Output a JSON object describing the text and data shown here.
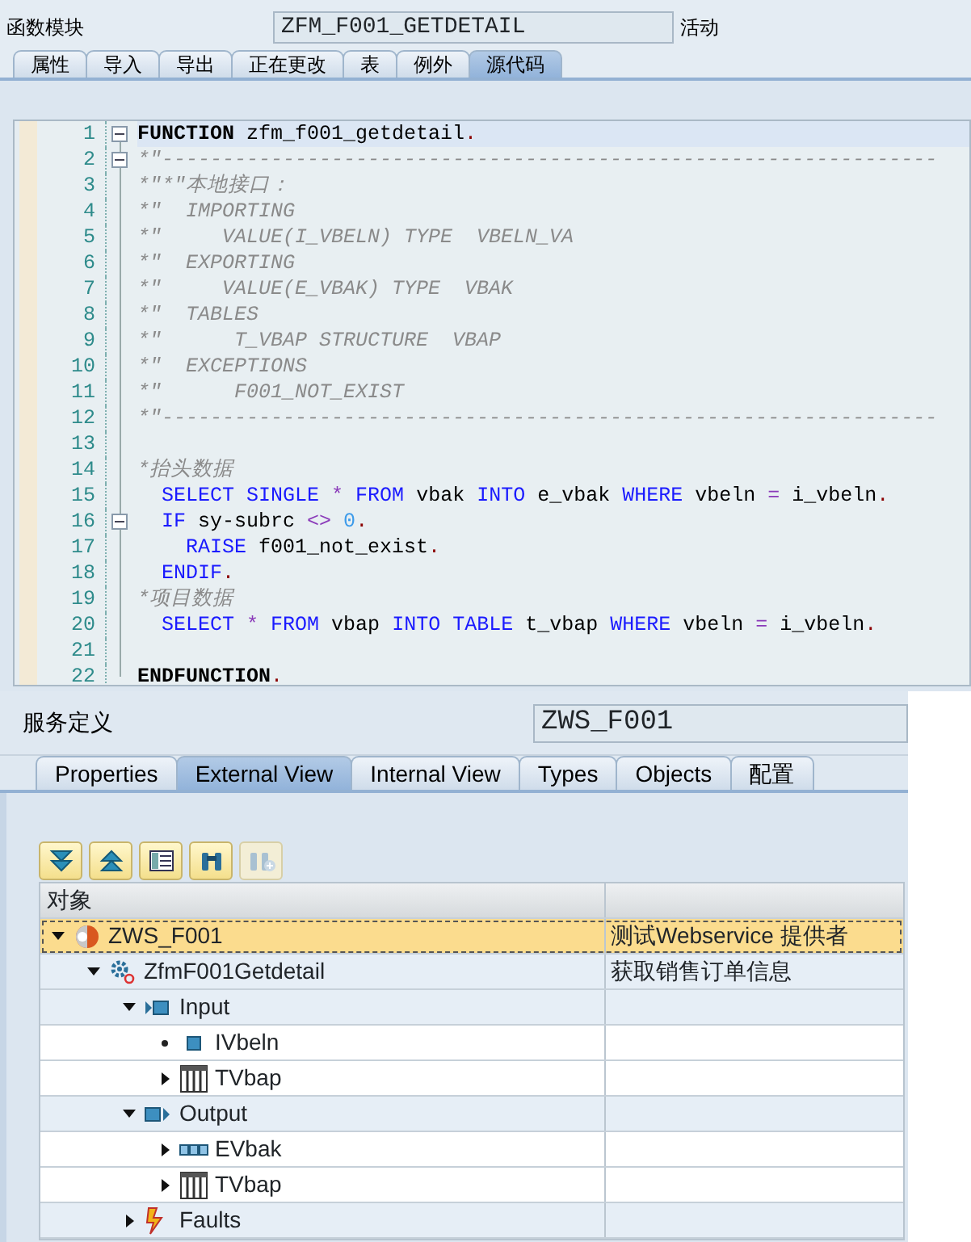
{
  "function_editor": {
    "field_label": "函数模块",
    "field_value": "ZFM_F001_GETDETAIL",
    "status": "活动",
    "tabs": [
      {
        "label": "属性",
        "selected": false
      },
      {
        "label": "导入",
        "selected": false
      },
      {
        "label": "导出",
        "selected": false
      },
      {
        "label": "正在更改",
        "selected": false
      },
      {
        "label": "表",
        "selected": false
      },
      {
        "label": "例外",
        "selected": false
      },
      {
        "label": "源代码",
        "selected": true
      }
    ],
    "code_lines": [
      {
        "number": "1",
        "fold_box": true,
        "current": true,
        "tokens": [
          {
            "kind": "bold_keyword",
            "text": "FUNCTION"
          },
          {
            "kind": "text",
            "text": " zfm_f001_getdetail"
          },
          {
            "kind": "punct",
            "text": "."
          }
        ]
      },
      {
        "number": "2",
        "fold_box": true,
        "current": false,
        "tokens": [
          {
            "kind": "comment",
            "text": "*\"----------------------------------------------------------------"
          }
        ]
      },
      {
        "number": "3",
        "fold_box": false,
        "current": false,
        "tokens": [
          {
            "kind": "comment",
            "text": "*\"*\"本地接口："
          }
        ]
      },
      {
        "number": "4",
        "fold_box": false,
        "current": false,
        "tokens": [
          {
            "kind": "comment",
            "text": "*\"  IMPORTING"
          }
        ]
      },
      {
        "number": "5",
        "fold_box": false,
        "current": false,
        "tokens": [
          {
            "kind": "comment",
            "text": "*\"     VALUE(I_VBELN) TYPE  VBELN_VA"
          }
        ]
      },
      {
        "number": "6",
        "fold_box": false,
        "current": false,
        "tokens": [
          {
            "kind": "comment",
            "text": "*\"  EXPORTING"
          }
        ]
      },
      {
        "number": "7",
        "fold_box": false,
        "current": false,
        "tokens": [
          {
            "kind": "comment",
            "text": "*\"     VALUE(E_VBAK) TYPE  VBAK"
          }
        ]
      },
      {
        "number": "8",
        "fold_box": false,
        "current": false,
        "tokens": [
          {
            "kind": "comment",
            "text": "*\"  TABLES"
          }
        ]
      },
      {
        "number": "9",
        "fold_box": false,
        "current": false,
        "tokens": [
          {
            "kind": "comment",
            "text": "*\"      T_VBAP STRUCTURE  VBAP"
          }
        ]
      },
      {
        "number": "10",
        "fold_box": false,
        "current": false,
        "tokens": [
          {
            "kind": "comment",
            "text": "*\"  EXCEPTIONS"
          }
        ]
      },
      {
        "number": "11",
        "fold_box": false,
        "current": false,
        "tokens": [
          {
            "kind": "comment",
            "text": "*\"      F001_NOT_EXIST"
          }
        ]
      },
      {
        "number": "12",
        "fold_box": false,
        "current": false,
        "tokens": [
          {
            "kind": "comment",
            "text": "*\"----------------------------------------------------------------"
          }
        ]
      },
      {
        "number": "13",
        "fold_box": false,
        "current": false
      },
      {
        "number": "14",
        "fold_box": false,
        "current": false,
        "tokens": [
          {
            "kind": "comment",
            "text": "*抬头数据"
          }
        ]
      },
      {
        "number": "15",
        "fold_box": false,
        "current": false,
        "tokens": [
          {
            "kind": "keyword",
            "text": "  SELECT SINGLE"
          },
          {
            "kind": "operator",
            "text": " *"
          },
          {
            "kind": "keyword",
            "text": " FROM"
          },
          {
            "kind": "text",
            "text": " vbak"
          },
          {
            "kind": "keyword",
            "text": " INTO"
          },
          {
            "kind": "text",
            "text": " e_vbak"
          },
          {
            "kind": "keyword",
            "text": " WHERE"
          },
          {
            "kind": "text",
            "text": " vbeln"
          },
          {
            "kind": "operator",
            "text": " ="
          },
          {
            "kind": "text",
            "text": " i_vbeln"
          },
          {
            "kind": "punct",
            "text": "."
          }
        ]
      },
      {
        "number": "16",
        "fold_box": true,
        "current": false,
        "tokens": [
          {
            "kind": "keyword",
            "text": "  IF"
          },
          {
            "kind": "text",
            "text": " sy-subrc"
          },
          {
            "kind": "operator",
            "text": " <>"
          },
          {
            "kind": "number",
            "text": " 0"
          },
          {
            "kind": "punct",
            "text": "."
          }
        ]
      },
      {
        "number": "17",
        "fold_box": false,
        "current": false,
        "tokens": [
          {
            "kind": "keyword",
            "text": "    RAISE"
          },
          {
            "kind": "text",
            "text": " f001_not_exist"
          },
          {
            "kind": "punct",
            "text": "."
          }
        ]
      },
      {
        "number": "18",
        "fold_box": false,
        "current": false,
        "tokens": [
          {
            "kind": "keyword",
            "text": "  ENDIF"
          },
          {
            "kind": "punct",
            "text": "."
          }
        ]
      },
      {
        "number": "19",
        "fold_box": false,
        "current": false,
        "tokens": [
          {
            "kind": "comment",
            "text": "*项目数据"
          }
        ]
      },
      {
        "number": "20",
        "fold_box": false,
        "current": false,
        "tokens": [
          {
            "kind": "keyword",
            "text": "  SELECT"
          },
          {
            "kind": "operator",
            "text": " *"
          },
          {
            "kind": "keyword",
            "text": " FROM"
          },
          {
            "kind": "text",
            "text": " vbap"
          },
          {
            "kind": "keyword",
            "text": " INTO TABLE"
          },
          {
            "kind": "text",
            "text": " t_vbap"
          },
          {
            "kind": "keyword",
            "text": " WHERE"
          },
          {
            "kind": "text",
            "text": " vbeln"
          },
          {
            "kind": "operator",
            "text": " ="
          },
          {
            "kind": "text",
            "text": " i_vbeln"
          },
          {
            "kind": "punct",
            "text": "."
          }
        ]
      },
      {
        "number": "21",
        "fold_box": false,
        "current": false
      },
      {
        "number": "22",
        "fold_box": false,
        "current": false,
        "tokens": [
          {
            "kind": "bold_keyword",
            "text": "ENDFUNCTION"
          },
          {
            "kind": "punct",
            "text": "."
          }
        ]
      }
    ]
  },
  "service_definition": {
    "field_label": "服务定义",
    "field_value": "ZWS_F001",
    "tabs": [
      {
        "label": "Properties",
        "selected": false
      },
      {
        "label": "External View",
        "selected": true
      },
      {
        "label": "Internal View",
        "selected": false
      },
      {
        "label": "Types",
        "selected": false
      },
      {
        "label": "Objects",
        "selected": false
      },
      {
        "label": "配置",
        "selected": false
      }
    ],
    "toolbar": [
      {
        "kind": "expand_all",
        "disabled": false
      },
      {
        "kind": "collapse_all",
        "disabled": false
      },
      {
        "kind": "details",
        "disabled": false
      },
      {
        "kind": "find",
        "disabled": false
      },
      {
        "kind": "find_next",
        "disabled": true
      }
    ],
    "tree": {
      "columns": [
        "对象"
      ],
      "nodes": [
        {
          "name": "ZWS_F001",
          "description": "测试Webservice 提供者",
          "kind": "service",
          "expanded": true,
          "selected": true,
          "children": [
            {
              "name": "ZfmF001Getdetail",
              "description": "获取销售订单信息",
              "kind": "operation",
              "expanded": true,
              "selected": false,
              "children": [
                {
                  "name": "Input",
                  "kind": "input",
                  "expanded": true,
                  "selected": false,
                  "children": [
                    {
                      "name": "IVbeln",
                      "kind": "element",
                      "selected": false
                    },
                    {
                      "name": "TVbap",
                      "kind": "table",
                      "expanded": false,
                      "selected": false
                    }
                  ]
                },
                {
                  "name": "Output",
                  "kind": "output",
                  "expanded": true,
                  "selected": false,
                  "children": [
                    {
                      "name": "EVbak",
                      "kind": "structure",
                      "expanded": false,
                      "selected": false
                    },
                    {
                      "name": "TVbap",
                      "kind": "table",
                      "expanded": false,
                      "selected": false
                    }
                  ]
                },
                {
                  "name": "Faults",
                  "kind": "faults",
                  "expanded": false,
                  "selected": false
                }
              ]
            }
          ]
        }
      ]
    }
  }
}
